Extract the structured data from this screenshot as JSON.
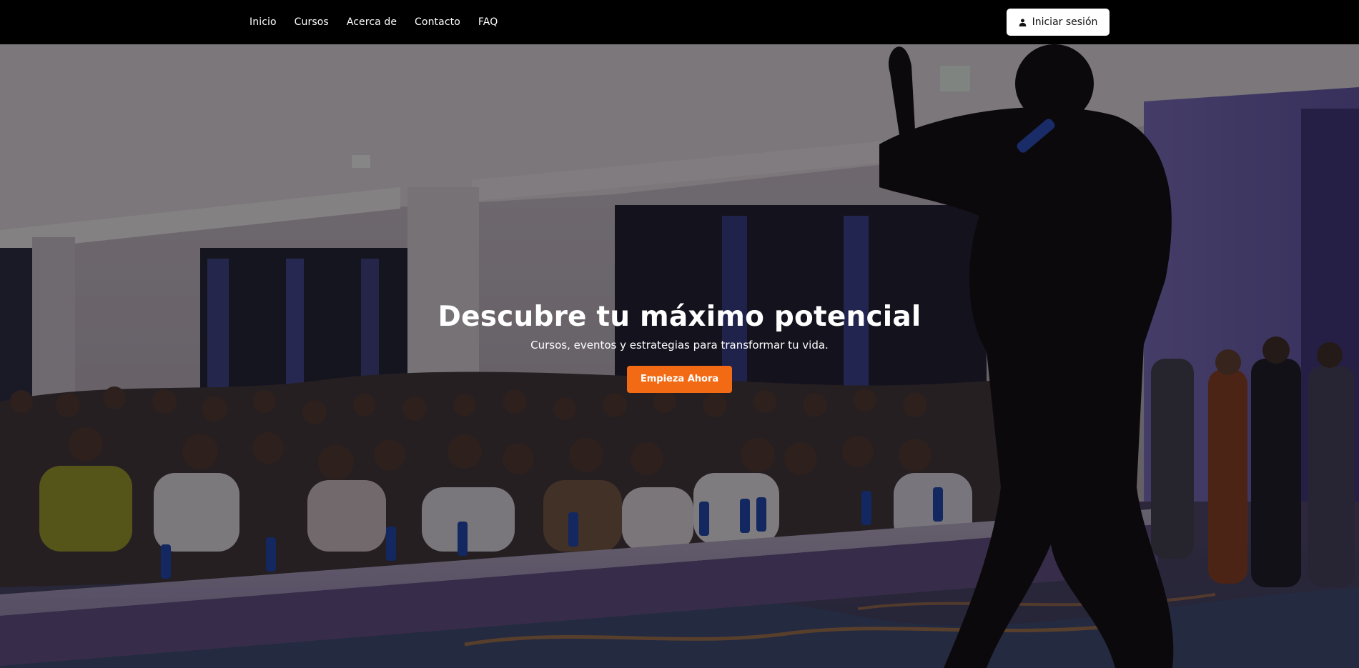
{
  "nav": {
    "items": [
      {
        "label": "Inicio"
      },
      {
        "label": "Cursos"
      },
      {
        "label": "Acerca de"
      },
      {
        "label": "Contacto"
      },
      {
        "label": "FAQ"
      }
    ],
    "login_label": "Iniciar sesión",
    "login_icon": "user-icon"
  },
  "hero": {
    "title": "Descubre tu máximo potencial",
    "subtitle": "Cursos, eventos y estrategias para transformar tu vida.",
    "cta_label": "Empieza Ahora",
    "background_image": "conference-audience-photo"
  },
  "colors": {
    "topbar": "#000000",
    "accent": "#f26a14",
    "login_bg": "#ffffff",
    "text_light": "#ffffff"
  }
}
